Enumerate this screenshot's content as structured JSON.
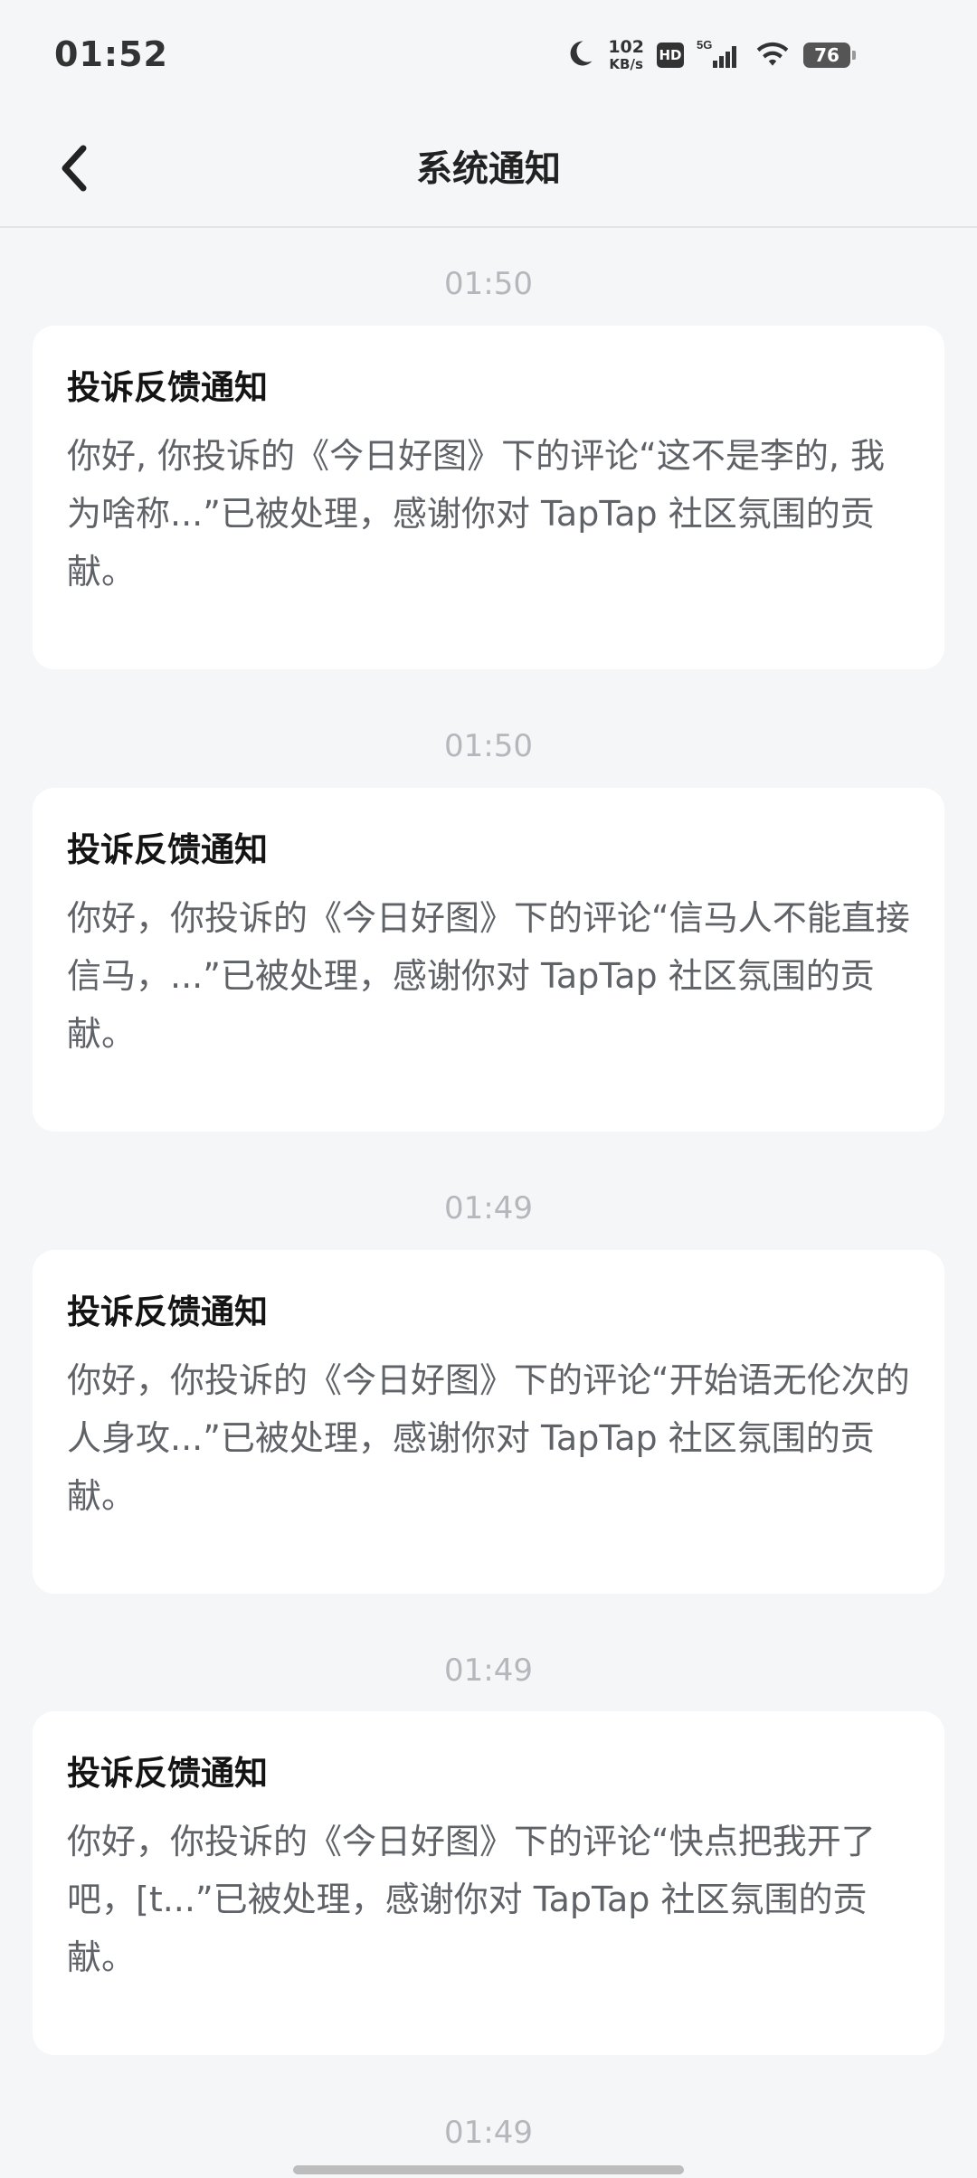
{
  "status_bar": {
    "time": "01:52",
    "net_speed_value": "102",
    "net_speed_unit": "KB/s",
    "hd_label": "HD",
    "network_label": "5G",
    "battery_level": "76"
  },
  "header": {
    "title": "系统通知"
  },
  "notifications": [
    {
      "time": "01:50",
      "title": "投诉反馈通知",
      "body": "你好, 你投诉的《今日好图》下的评论“这不是李的, 我为啥称...”已被处理，感谢你对 TapTap 社区氛围的贡献。"
    },
    {
      "time": "01:50",
      "title": "投诉反馈通知",
      "body": "你好，你投诉的《今日好图》下的评论“信马人不能直接信马，...”已被处理，感谢你对 TapTap 社区氛围的贡献。"
    },
    {
      "time": "01:49",
      "title": "投诉反馈通知",
      "body": "你好，你投诉的《今日好图》下的评论“开始语无伦次的人身攻...”已被处理，感谢你对 TapTap 社区氛围的贡献。"
    },
    {
      "time": "01:49",
      "title": "投诉反馈通知",
      "body": "你好，你投诉的《今日好图》下的评论“快点把我开了吧，[t...”已被处理，感谢你对 TapTap 社区氛围的贡献。"
    }
  ],
  "next_time": "01:49",
  "colors": {
    "background": "#f5f6f8",
    "card": "#ffffff",
    "timestamp": "#b4b7bb",
    "body_text": "#5f6368"
  }
}
